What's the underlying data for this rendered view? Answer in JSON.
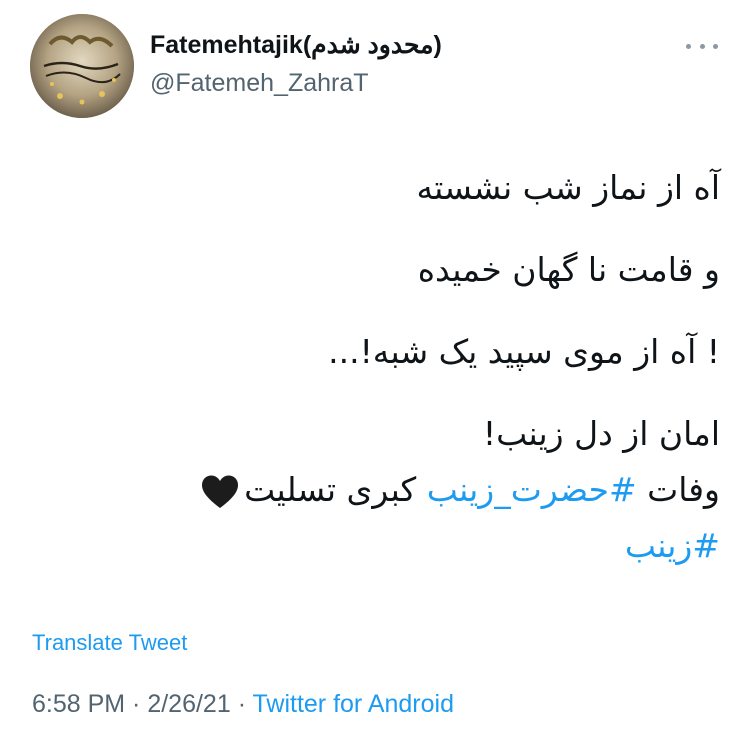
{
  "colors": {
    "accent": "#1d9bf0",
    "text": "#0f1419",
    "secondary": "#536471"
  },
  "author": {
    "display_name": "Fatemehtajik(محدود شدم)",
    "handle": "@Fatemeh_ZahraT",
    "avatar_icon": "profile-avatar"
  },
  "more_icon": "more-horizontal-icon",
  "tweet": {
    "lines": [
      "آه از نماز شب نشسته",
      "و قامت نا گهان خمیده",
      "! آه از موی سپید یک شبه!...",
      "امان از دل زینب!"
    ],
    "line5_prefix": "وفات ",
    "line5_tag": "#حضرت_زینب",
    "line5_suffix": " کبری تسلیت",
    "heart_icon": "black-heart-icon",
    "hashtag": "#زینب"
  },
  "translate_label": "Translate Tweet",
  "meta": {
    "time": "6:58 PM",
    "sep1": " · ",
    "date": "2/26/21",
    "sep2": " · ",
    "source": "Twitter for Android"
  }
}
